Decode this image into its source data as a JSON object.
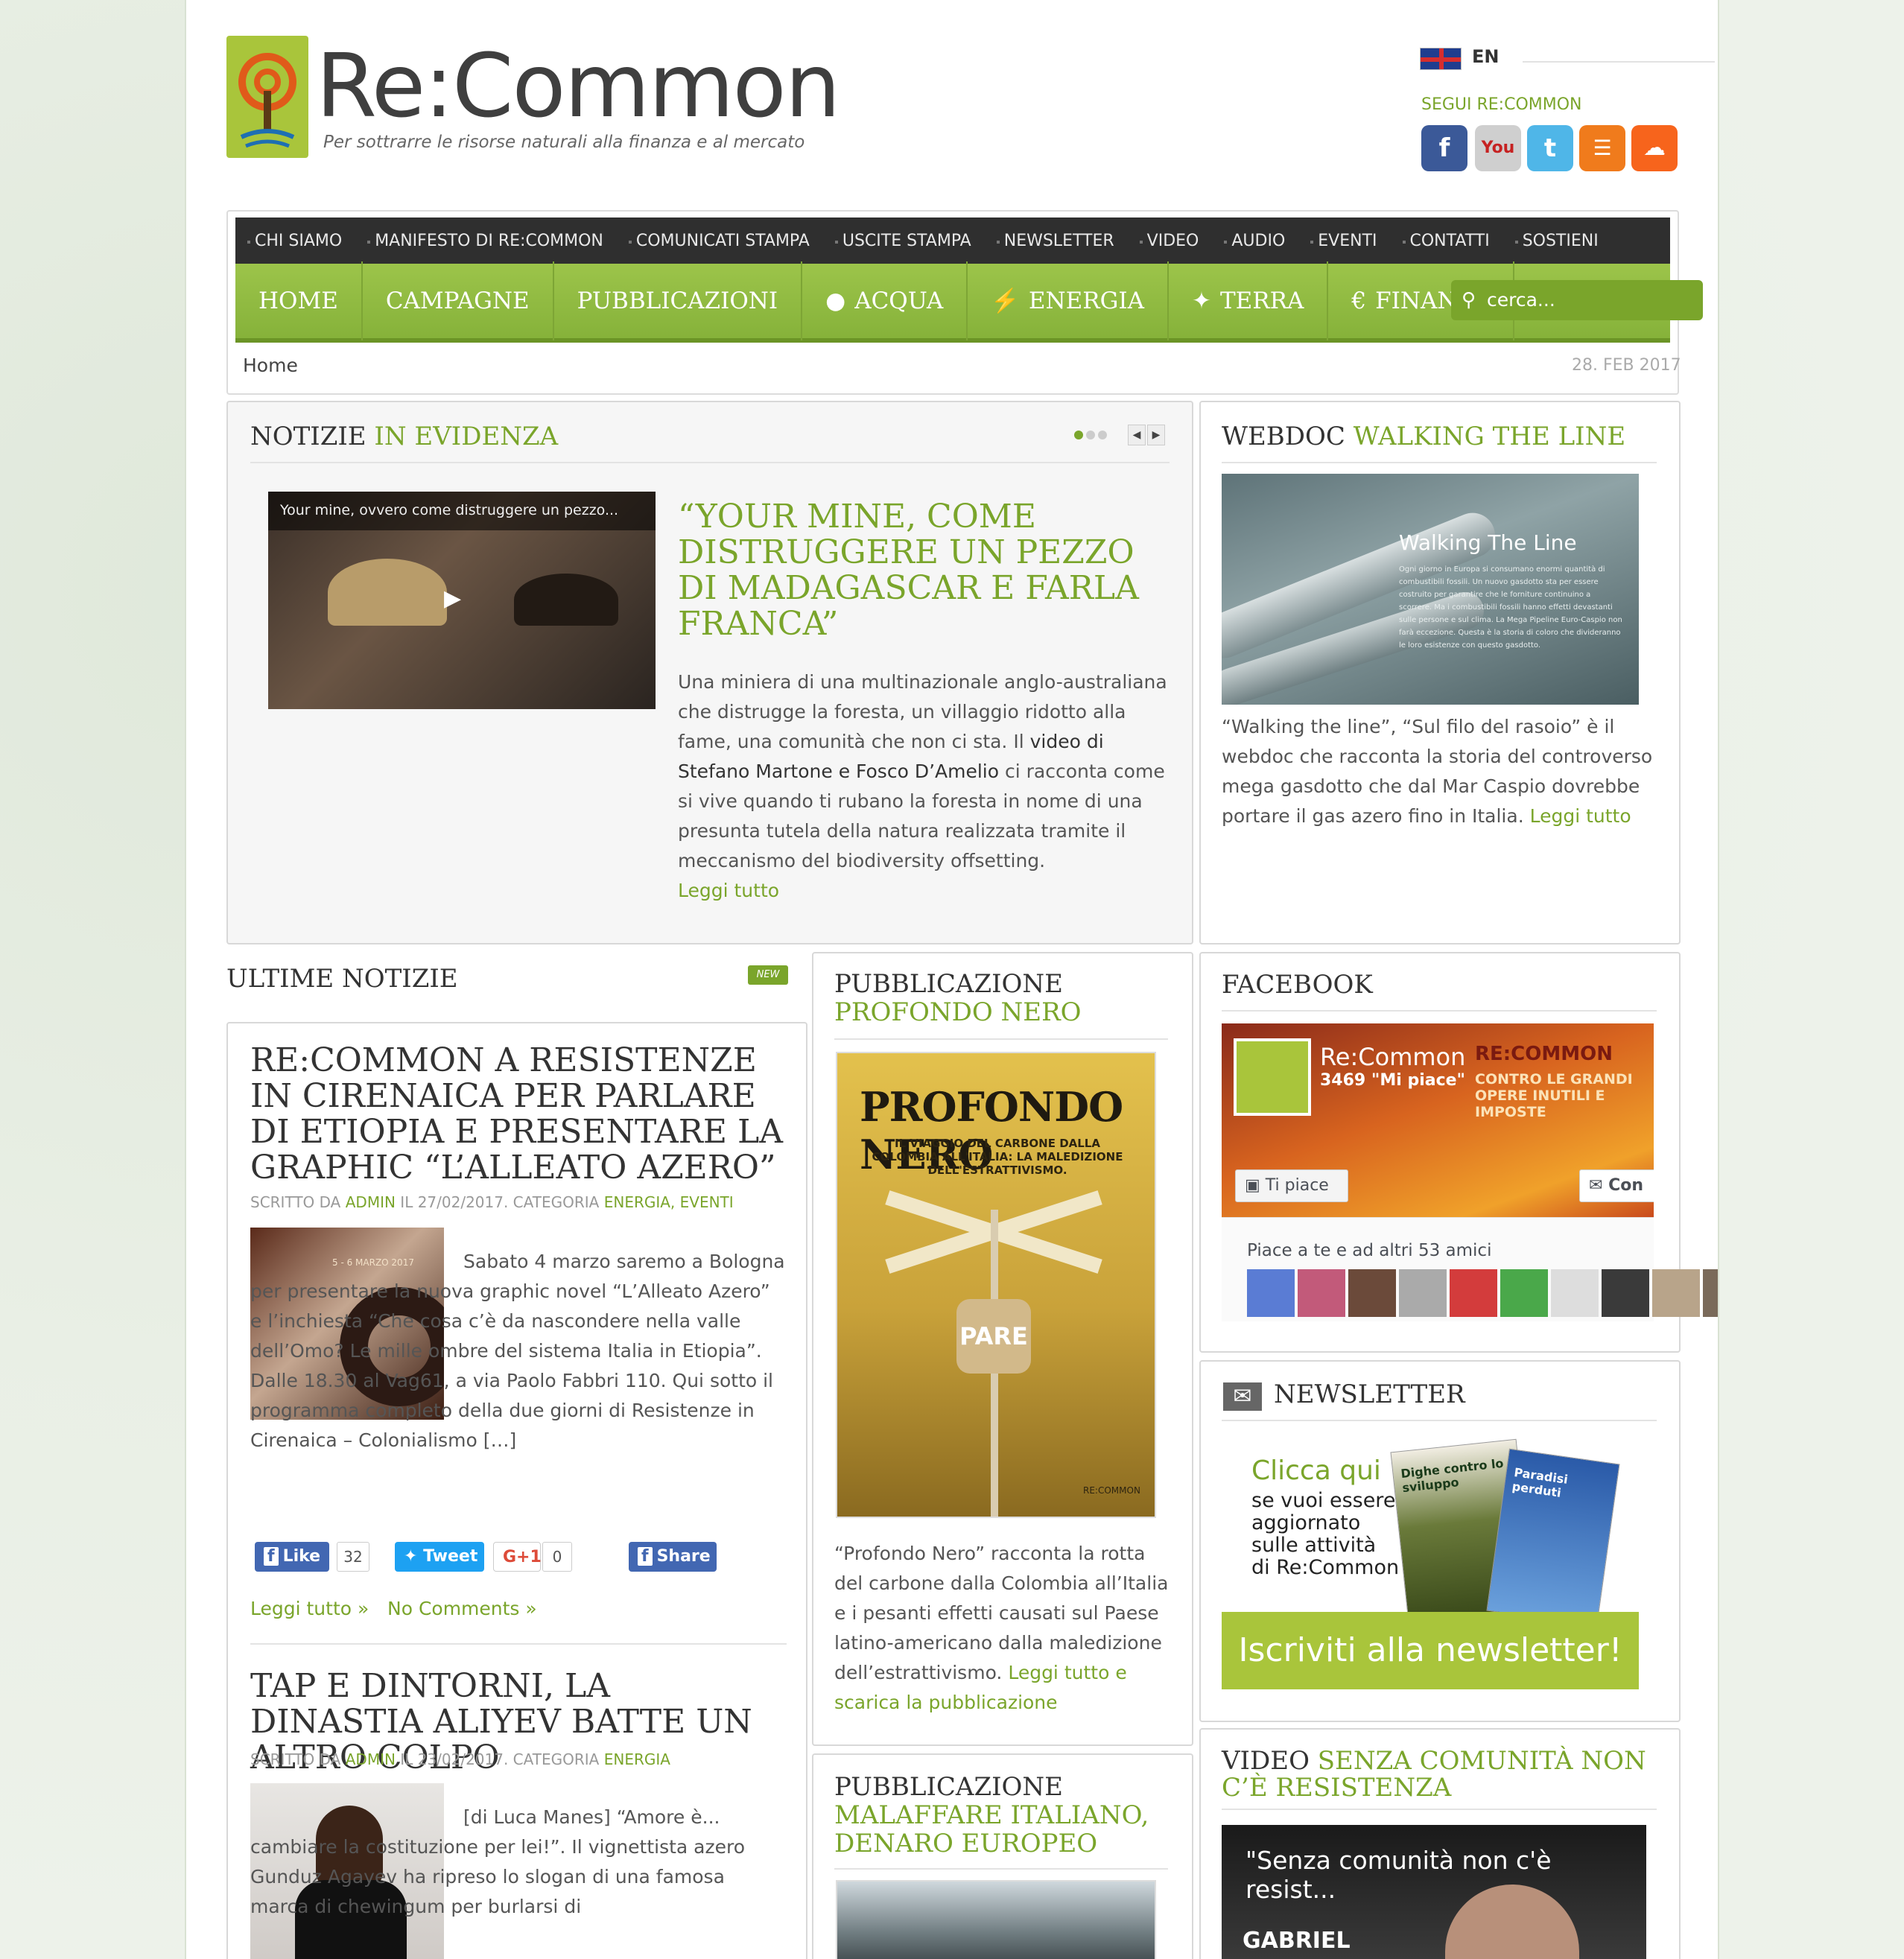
{
  "logo": {
    "title": "Re:Common",
    "subtitle": "Per sottrarre le risorse naturali alla finanza e al mercato"
  },
  "lang": "EN",
  "follow": "SEGUI RE:COMMON",
  "social": [
    {
      "icon": "facebook-icon",
      "glyph": "f",
      "color": "#3b5998"
    },
    {
      "icon": "youtube-icon",
      "glyph": "You",
      "color": "#c9c9c9"
    },
    {
      "icon": "twitter-icon",
      "glyph": "t",
      "color": "#4fb6e8"
    },
    {
      "icon": "rss-icon",
      "glyph": "☰",
      "color": "#f07b1c"
    },
    {
      "icon": "soundcloud-icon",
      "glyph": "☁",
      "color": "#f7641c"
    }
  ],
  "topnav": [
    "CHI SIAMO",
    "MANIFESTO DI RE:COMMON",
    "COMUNICATI STAMPA",
    "USCITE STAMPA",
    "NEWSLETTER",
    "VIDEO",
    "AUDIO",
    "EVENTI",
    "CONTATTI",
    "SOSTIENI"
  ],
  "mainnav": [
    {
      "label": "HOME",
      "icon": ""
    },
    {
      "label": "CAMPAGNE",
      "icon": ""
    },
    {
      "label": "PUBBLICAZIONI",
      "icon": ""
    },
    {
      "label": "ACQUA",
      "icon": "water-drop-icon",
      "glyph": "●"
    },
    {
      "label": "ENERGIA",
      "icon": "lightning-icon",
      "glyph": "⚡"
    },
    {
      "label": "TERRA",
      "icon": "wheat-icon",
      "glyph": "✦"
    },
    {
      "label": "FINANZA",
      "icon": "euro-icon",
      "glyph": "€"
    }
  ],
  "search": {
    "placeholder": "cerca..."
  },
  "breadcrumb": "Home",
  "date": "28. FEB 2017",
  "featured": {
    "heading_a": "NOTIZIE",
    "heading_b": "IN EVIDENZA",
    "video_title": "Your mine, ovvero come distruggere un pezzo...",
    "title": "“YOUR MINE, COME DISTRUGGERE UN PEZZO DI MADAGASCAR E FARLA FRANCA”",
    "text_a": "Una miniera di una multinazionale anglo-australiana che distrugge la foresta, un villaggio ridotto alla fame, una comunità che non ci sta. Il",
    "text_link": "video di Stefano Martone e Fosco D’Amelio",
    "text_b": "ci racconta come si vive quando ti rubano la foresta in nome di una presunta tutela della natura realizzata tramite il meccanismo del biodiversity offsetting.",
    "more": "Leggi tutto"
  },
  "webdoc": {
    "heading_a": "WEBDOC",
    "heading_b": "WALKING THE LINE",
    "image_title": "Walking The Line",
    "image_text": "Ogni giorno in Europa si consumano enormi quantità di combustibili fossili. Un nuovo gasdotto sta per essere costruito per garantire che le forniture continuino a scorrere. Ma i combustibili fossili hanno effetti devastanti sulle persone e sul clima. La Mega Pipeline Euro-Caspio non farà eccezione. Questa è la storia di coloro che divideranno le loro esistenze con questo gasdotto.",
    "text": "“Walking the line”, “Sul filo del rasoio” è il webdoc che racconta la storia del controverso mega gasdotto che dal Mar Caspio dovrebbe portare il gas azero fino in Italia.",
    "more": "Leggi tutto"
  },
  "latest": {
    "heading": "ULTIME NOTIZIE",
    "badge": "NEW",
    "posts": [
      {
        "title": "RE:COMMON A RESISTENZE IN CIRENAICA PER PARLARE DI ETIOPIA E PRESENTARE LA GRAPHIC “L’ALLEATO AZERO”",
        "meta_a": "SCRITTO DA",
        "author": "ADMIN",
        "meta_b": "IL 27/02/2017. CATEGORIA",
        "cats": "ENERGIA, EVENTI",
        "image_label": "5 - 6 MARZO 2017",
        "excerpt": "Sabato 4 marzo saremo a Bologna per presentare la nuova graphic novel “L’Alleato Azero” e l’inchiesta “Che cosa c’è da nascondere nella valle dell’Omo? Le mille ombre del sistema Italia in Etiopia”. Dalle 18.30 al Vag61, a via Paolo Fabbri 110. Qui sotto il programma completo della due giorni di Resistenze in Cirenaica – Colonialismo […]",
        "like": "Like",
        "like_count": "32",
        "tweet": "Tweet",
        "gplus": "G+1",
        "gplus_count": "0",
        "share": "Share",
        "more": "Leggi tutto »",
        "comments": "No Comments »"
      },
      {
        "title": "TAP E DINTORNI, LA DINASTIA ALIYEV BATTE UN ALTRO COLPO",
        "meta_a": "SCRITTO DA",
        "author": "ADMIN",
        "meta_b": "IL 23/02/2017. CATEGORIA",
        "cats": "ENERGIA",
        "excerpt": "[di Luca Manes] “Amore è... cambiare la costituzione per lei!”. Il vignettista azero Gunduz Agayev ha ripreso lo slogan di una famosa marca di chewingum per burlarsi di"
      }
    ]
  },
  "pub1": {
    "heading_a": "PUBBLICAZIONE",
    "heading_b": "PROFONDO NERO",
    "cover_title": "PROFONDO NERO",
    "cover_sub": "IL VIAGGIO DEL CARBONE DALLA COLOMBIA ALL'ITALIA: LA MALEDIZIONE DELL'ESTRATTIVISMO.",
    "cover_sign": "PARE",
    "cover_publisher": "RE:COMMON",
    "text": "“Profondo Nero” racconta la rotta del carbone dalla Colombia all’Italia e i pesanti effetti causati sul Paese latino-americano dalla maledizione dell’estrattivismo.",
    "more": "Leggi tutto e scarica la pubblicazione"
  },
  "pub2": {
    "heading_a": "PUBBLICAZIONE",
    "heading_b": "MALAFFARE ITALIANO, DENARO EUROPEO"
  },
  "facebook": {
    "heading": "FACEBOOK",
    "page": "Re:Common",
    "likes": "3469 \"Mi piace\"",
    "banner_a": "RE:COMMON",
    "banner_b": "CONTRO LE GRANDI OPERE INUTILI E IMPOSTE",
    "like_btn": "Ti piace",
    "contact_btn": "Con",
    "friends": "Piace a te e ad altri 53 amici"
  },
  "newsletter": {
    "heading": "NEWSLETTER",
    "text_a": "Clicca qui",
    "text_b": "se vuoi essere aggiornato sulle attività di Re:Common",
    "mag_a": "Dighe contro lo sviluppo",
    "mag_b": "Paradisi perduti",
    "cta": "Iscriviti alla newsletter!"
  },
  "video": {
    "heading_a": "VIDEO",
    "heading_b": "SENZA COMUNITÀ NON C’È RESISTENZA",
    "title": "\"Senza comunità non c'è resist...",
    "caption": "GABRIEL"
  }
}
